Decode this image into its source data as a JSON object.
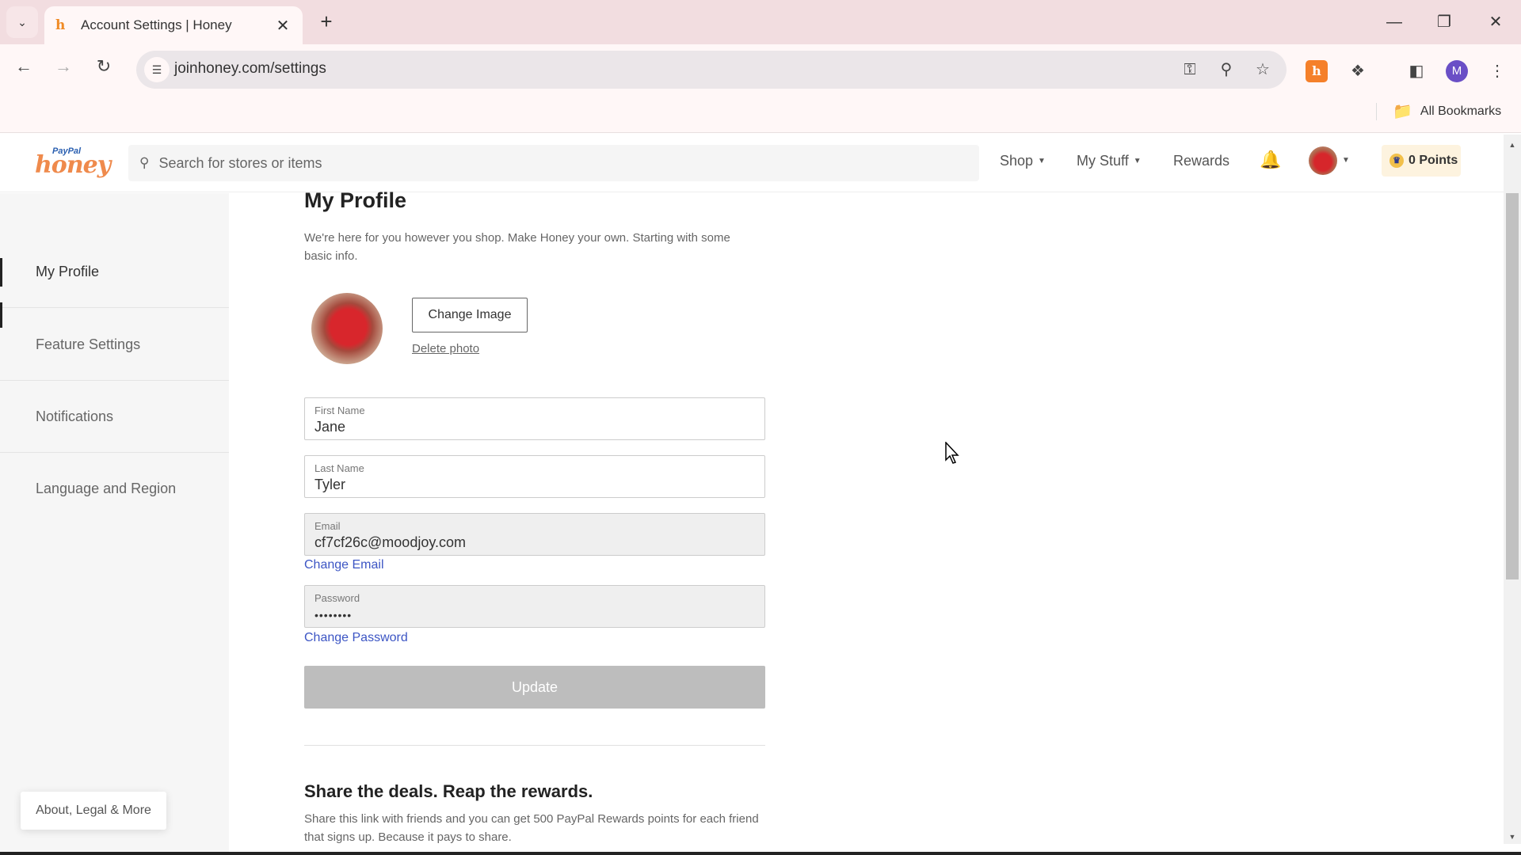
{
  "browser": {
    "tab_title": "Account Settings | Honey",
    "url": "joinhoney.com/settings",
    "all_bookmarks": "All Bookmarks",
    "profile_initial": "M"
  },
  "header": {
    "logo_top": "PayPal",
    "logo_main": "honey",
    "search_placeholder": "Search for stores or items",
    "nav": [
      {
        "label": "Shop",
        "has_dropdown": true
      },
      {
        "label": "My Stuff",
        "has_dropdown": true
      },
      {
        "label": "Rewards",
        "has_dropdown": false
      }
    ],
    "points_label": "0 Points"
  },
  "sidebar": {
    "items": [
      {
        "label": "My Profile",
        "active": true
      },
      {
        "label": "Feature Settings",
        "active": false
      },
      {
        "label": "Notifications",
        "active": false
      },
      {
        "label": "Language and Region",
        "active": false
      }
    ],
    "about_label": "About, Legal & More"
  },
  "profile": {
    "title": "My Profile",
    "intro": "We're here for you however you shop. Make Honey your own. Starting with some basic info.",
    "change_image_label": "Change Image",
    "delete_photo_label": "Delete photo",
    "fields": {
      "first_name": {
        "label": "First Name",
        "value": "Jane"
      },
      "last_name": {
        "label": "Last Name",
        "value": "Tyler"
      },
      "email": {
        "label": "Email",
        "value": "cf7cf26c@moodjoy.com"
      },
      "password": {
        "label": "Password",
        "value": "••••••••"
      }
    },
    "change_email_label": "Change Email",
    "change_password_label": "Change Password",
    "update_label": "Update"
  },
  "share": {
    "title": "Share the deals. Reap the rewards.",
    "description": "Share this link with friends and you can get 500 PayPal Rewards points for each friend that signs up. Because it pays to share."
  },
  "colors": {
    "accent_link": "#3c55c4",
    "honey_orange": "#ef8a4c",
    "points_bg": "#fdf3df",
    "disabled_button": "#bdbdbd"
  }
}
